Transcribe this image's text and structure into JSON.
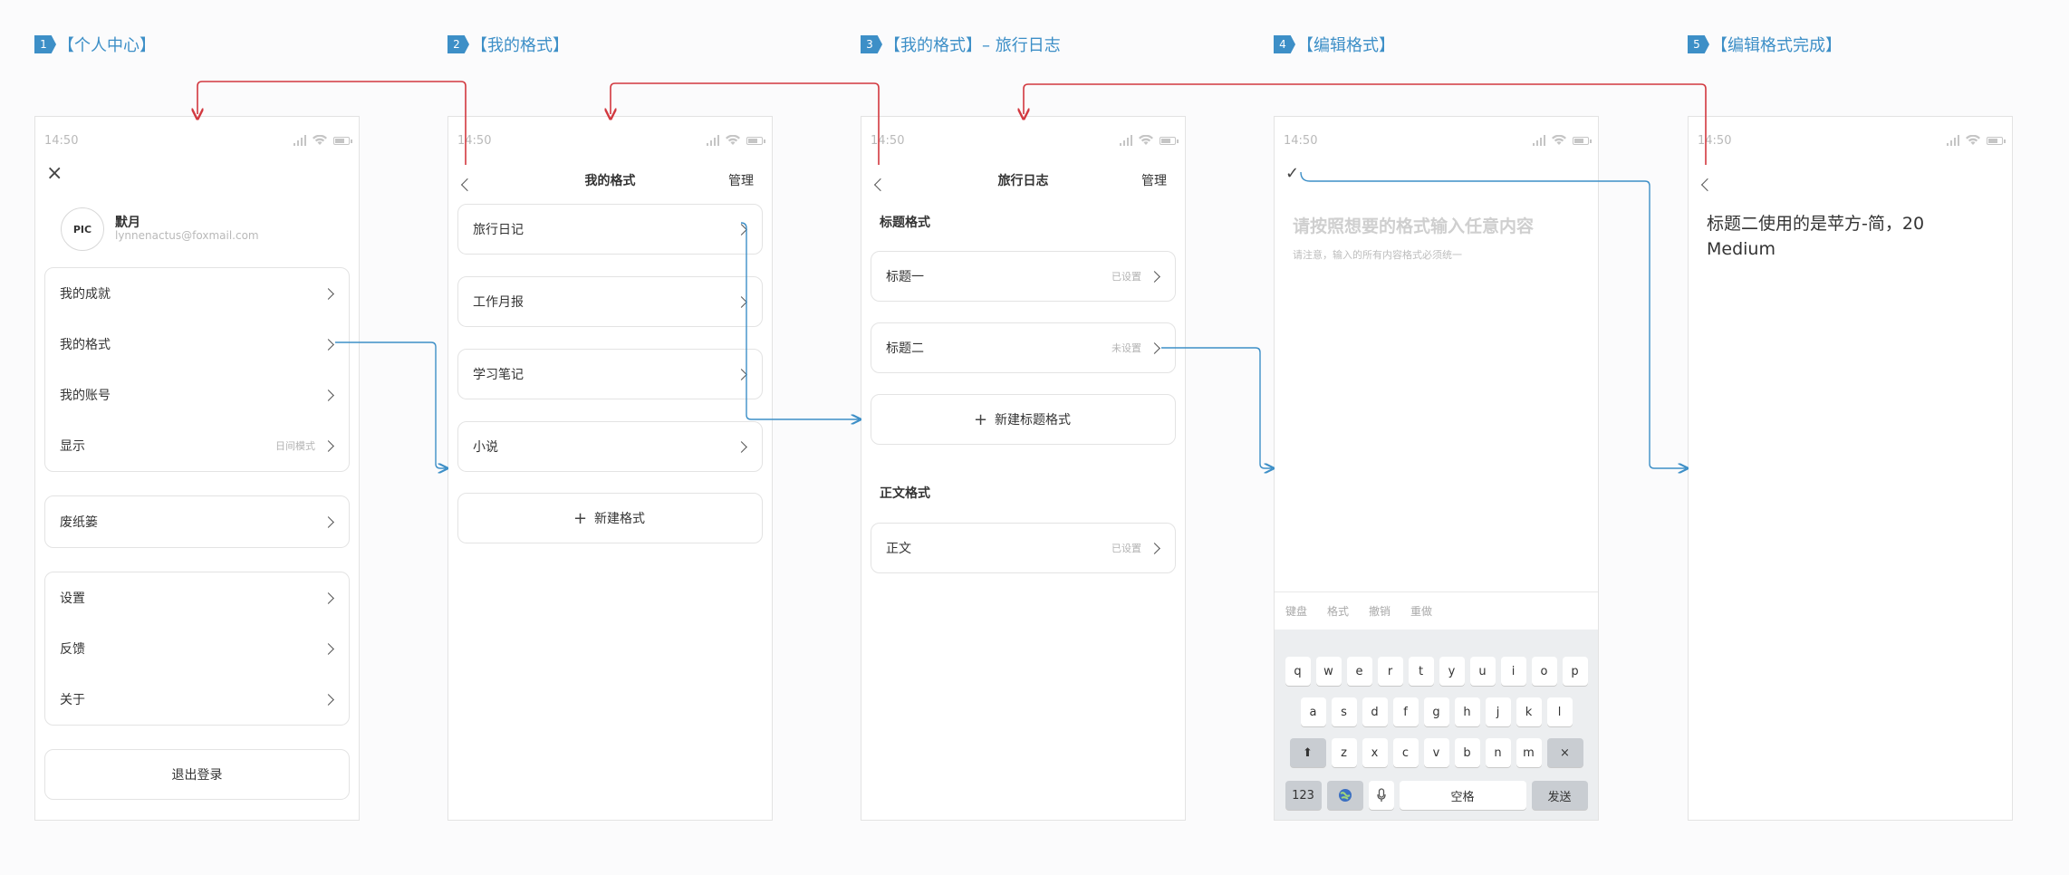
{
  "steps": [
    {
      "num": "1",
      "label": "【个人中心】"
    },
    {
      "num": "2",
      "label": "【我的格式】"
    },
    {
      "num": "3",
      "label": "【我的格式】– 旅行日志"
    },
    {
      "num": "4",
      "label": "【编辑格式】"
    },
    {
      "num": "5",
      "label": "【编辑格式完成】"
    }
  ],
  "status_time": "14:50",
  "screen1": {
    "close_icon": "close-icon",
    "avatar_text": "PIC",
    "user_name": "默月",
    "user_email": "lynnenactus@foxmail.com",
    "group1": [
      {
        "label": "我的成就",
        "hint": ""
      },
      {
        "label": "我的格式",
        "hint": ""
      },
      {
        "label": "我的账号",
        "hint": ""
      },
      {
        "label": "显示",
        "hint": "日间模式"
      }
    ],
    "group2": [
      {
        "label": "废纸篓",
        "hint": ""
      }
    ],
    "group3": [
      {
        "label": "设置",
        "hint": ""
      },
      {
        "label": "反馈",
        "hint": ""
      },
      {
        "label": "关于",
        "hint": ""
      }
    ],
    "logout": "退出登录"
  },
  "screen2": {
    "title": "我的格式",
    "manage": "管理",
    "items": [
      "旅行日记",
      "工作月报",
      "学习笔记",
      "小说"
    ],
    "new_format": "新建格式"
  },
  "screen3": {
    "title": "旅行日志",
    "manage": "管理",
    "heading_section": "标题格式",
    "headings": [
      {
        "label": "标题一",
        "status": "已设置"
      },
      {
        "label": "标题二",
        "status": "未设置"
      }
    ],
    "new_heading": "新建标题格式",
    "body_section": "正文格式",
    "body": [
      {
        "label": "正文",
        "status": "已设置"
      }
    ]
  },
  "screen4": {
    "placeholder": "请按照想要的格式输入任意内容",
    "hint": "请注意，输入的所有内容格式必须统一",
    "toolbar": [
      "键盘",
      "格式",
      "撤销",
      "重做"
    ],
    "keys_row1": [
      "q",
      "w",
      "e",
      "r",
      "t",
      "y",
      "u",
      "i",
      "o",
      "p"
    ],
    "keys_row2": [
      "a",
      "s",
      "d",
      "f",
      "g",
      "h",
      "j",
      "k",
      "l"
    ],
    "keys_row3": [
      "z",
      "x",
      "c",
      "v",
      "b",
      "n",
      "m"
    ],
    "key_123": "123",
    "key_space": "空格",
    "key_send": "发送",
    "key_delete": "×"
  },
  "screen5": {
    "text": "标题二使用的是苹方-简，20 Medium"
  },
  "colors": {
    "accent": "#3d8fc7",
    "back_arrow": "#d2383f",
    "forward_arrow": "#3d8fc7"
  }
}
